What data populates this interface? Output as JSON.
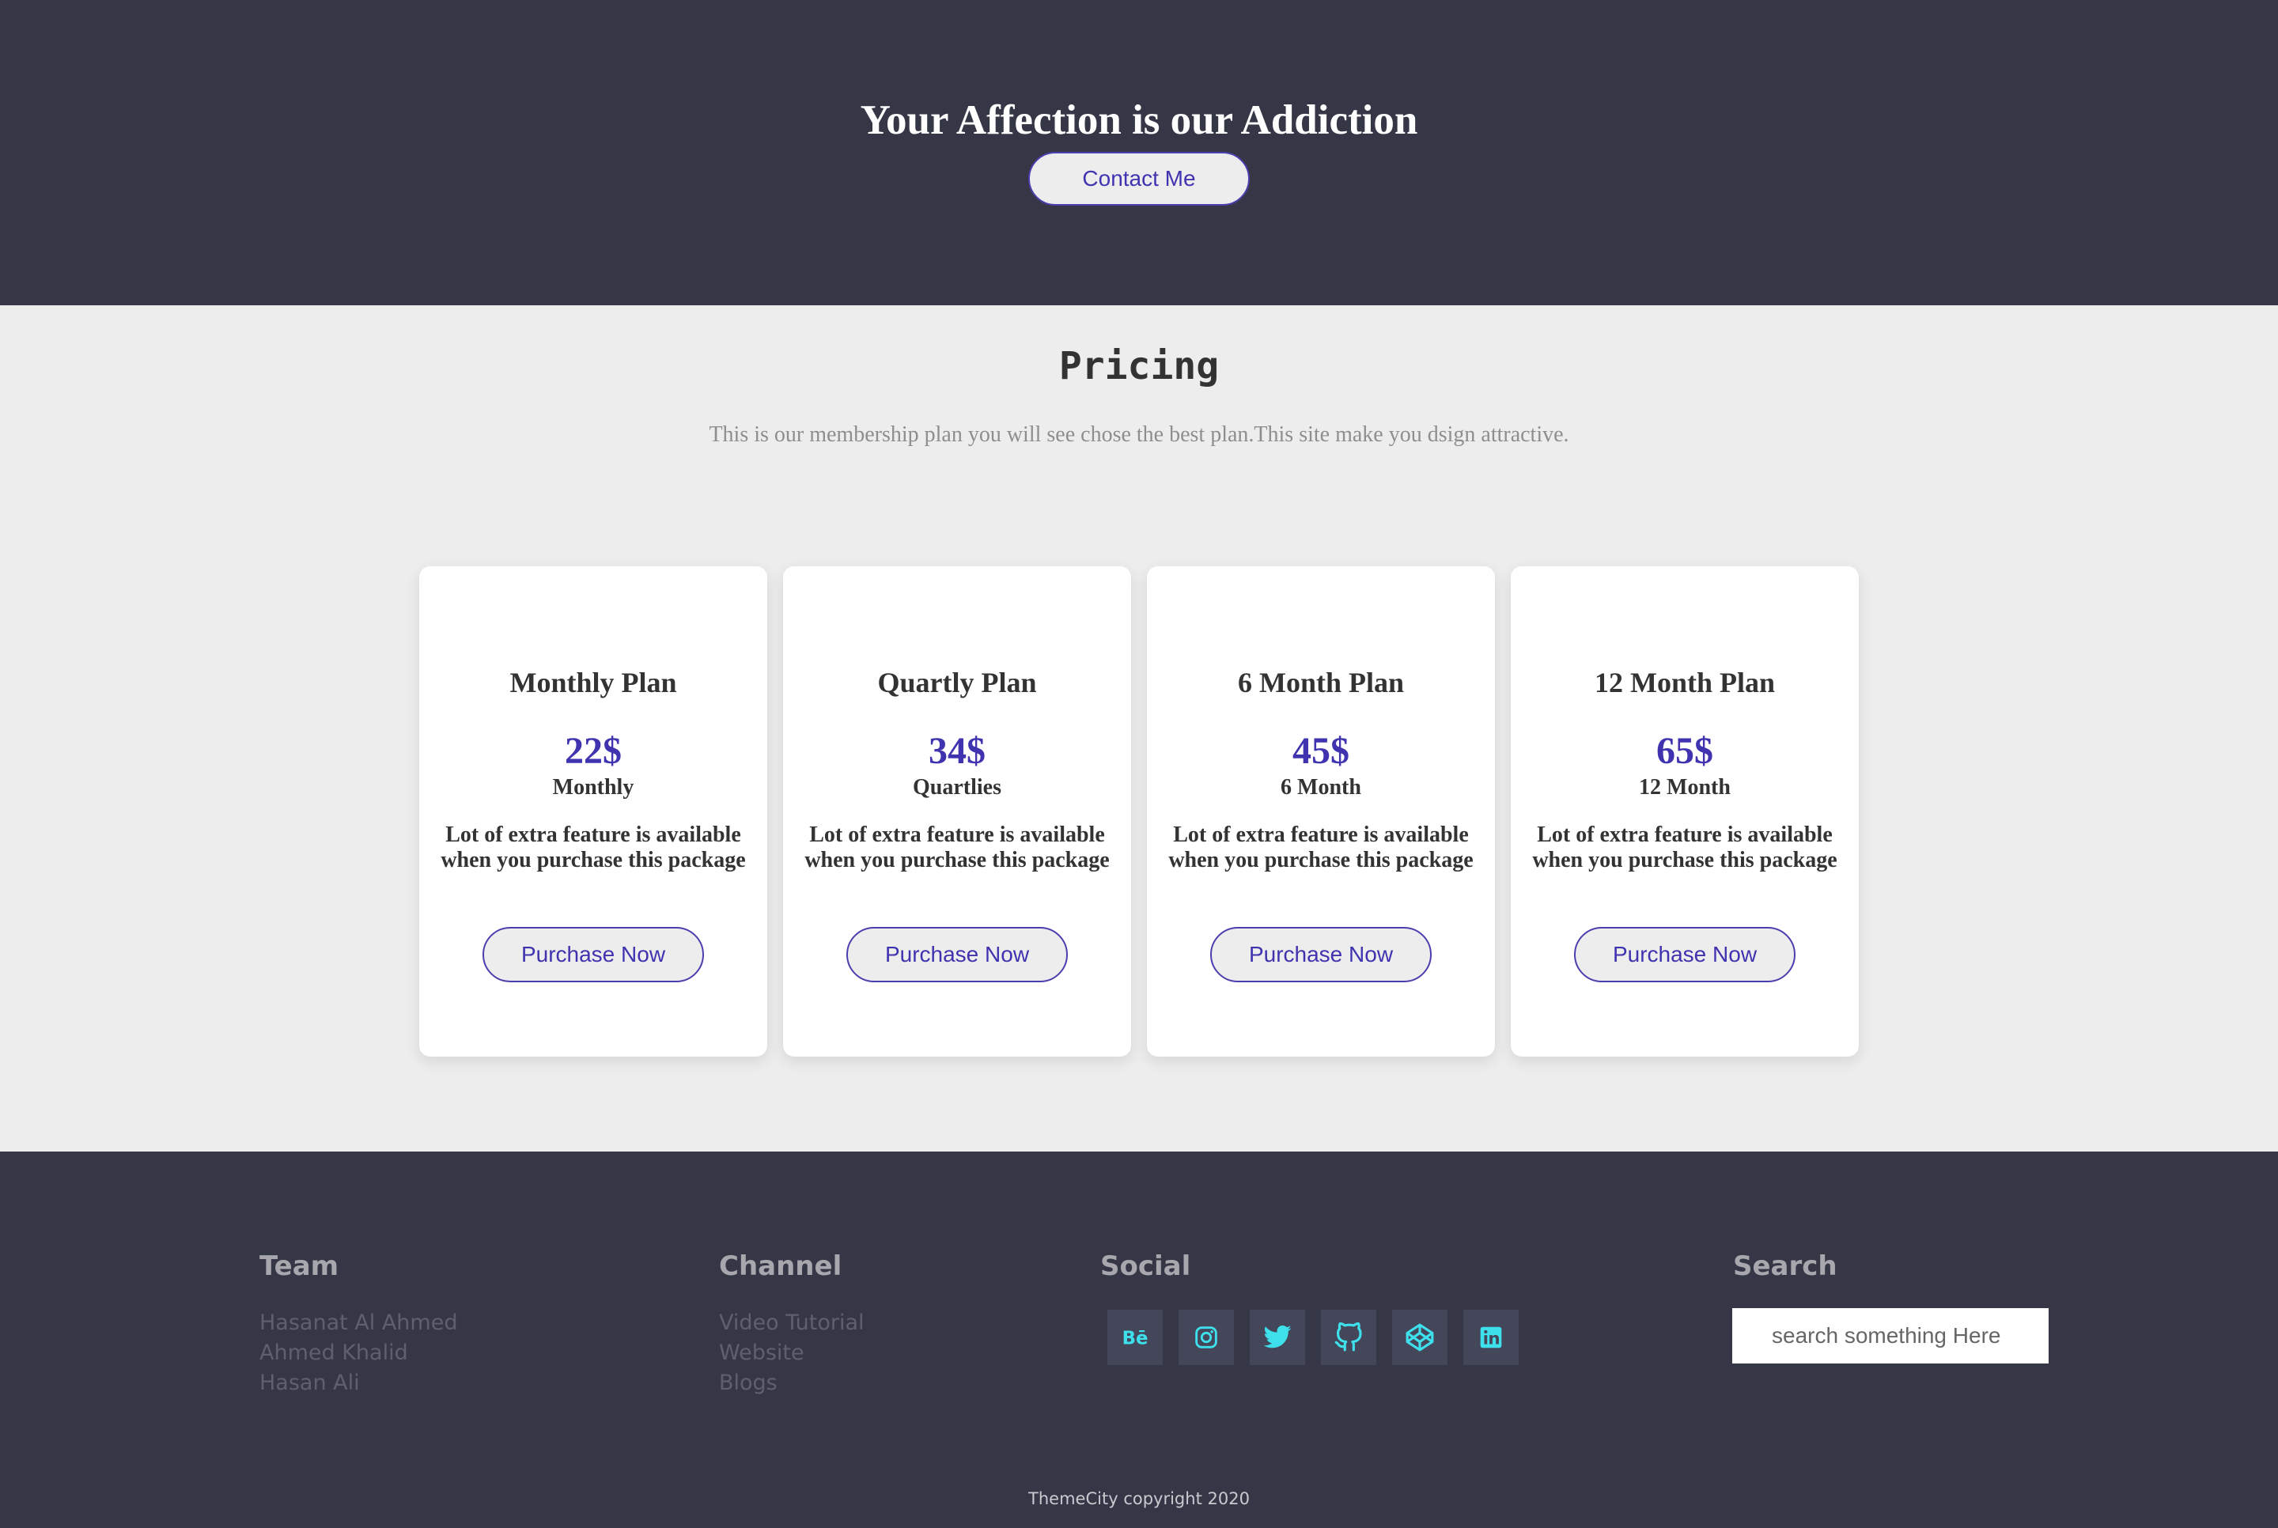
{
  "hero": {
    "title": "Your Affection is our Addiction",
    "contact_label": "Contact Me"
  },
  "pricing": {
    "title": "Pricing",
    "description": "This is our membership plan you will see chose the best plan.This site make you dsign attractive.",
    "plans": [
      {
        "name": "Monthly Plan",
        "price": "22$",
        "period": "Monthly",
        "feature": "Lot of extra feature is available when you purchase this package",
        "button": "Purchase Now"
      },
      {
        "name": "Quartly Plan",
        "price": "34$",
        "period": "Quartlies",
        "feature": "Lot of extra feature is available when you purchase this package",
        "button": "Purchase Now"
      },
      {
        "name": "6 Month Plan",
        "price": "45$",
        "period": "6 Month",
        "feature": "Lot of extra feature is available when you purchase this package",
        "button": "Purchase Now"
      },
      {
        "name": "12 Month Plan",
        "price": "65$",
        "period": "12 Month",
        "feature": "Lot of extra feature is available when you purchase this package",
        "button": "Purchase Now"
      }
    ]
  },
  "footer": {
    "team": {
      "heading": "Team",
      "items": [
        "Hasanat Al Ahmed",
        "Ahmed Khalid",
        "Hasan Ali"
      ]
    },
    "channel": {
      "heading": "Channel",
      "items": [
        "Video Tutorial",
        "Website",
        "Blogs"
      ]
    },
    "social": {
      "heading": "Social",
      "icons": [
        "behance-icon",
        "instagram-icon",
        "twitter-icon",
        "github-icon",
        "codepen-icon",
        "linkedin-icon"
      ]
    },
    "search": {
      "heading": "Search",
      "placeholder": "search something Here"
    },
    "copyright": "ThemeCity copyright 2020"
  },
  "colors": {
    "dark_bg": "#363746",
    "light_bg": "#ededed",
    "accent": "#3f33b0",
    "social_icon": "#3ee0ec"
  }
}
